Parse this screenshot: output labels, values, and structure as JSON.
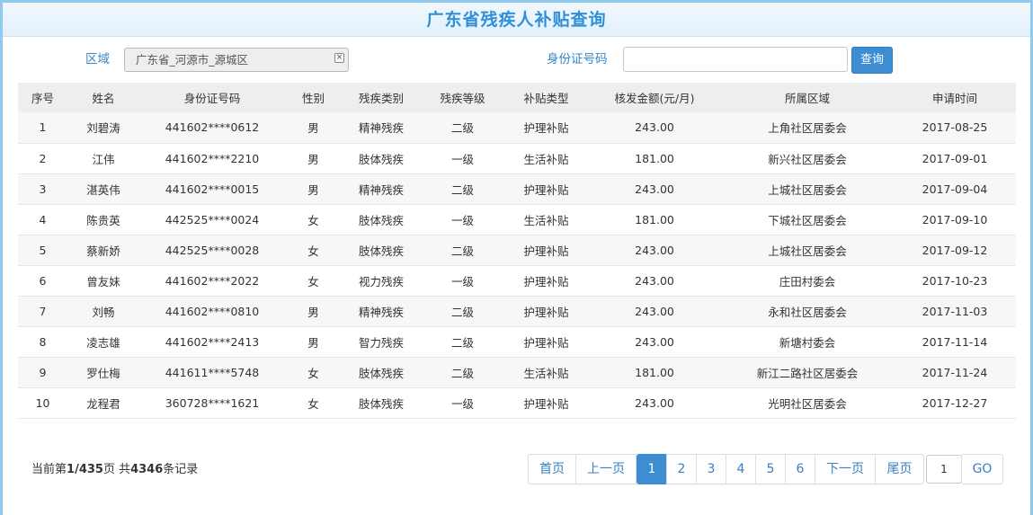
{
  "page": {
    "title": "广东省残疾人补贴查询"
  },
  "search": {
    "region_label": "区域",
    "region_value": "广东省_河源市_源城区",
    "clear_icon": "close-x-icon",
    "id_label": "身份证号码",
    "id_value": "",
    "id_placeholder": "",
    "query_label": "查询"
  },
  "table": {
    "headers": [
      "序号",
      "姓名",
      "身份证号码",
      "性别",
      "残疾类别",
      "残疾等级",
      "补贴类型",
      "核发金额(元/月)",
      "所属区域",
      "申请时间"
    ],
    "rows": [
      [
        "1",
        "刘碧涛",
        "441602****0612",
        "男",
        "精神残疾",
        "二级",
        "护理补贴",
        "243.00",
        "上角社区居委会",
        "2017-08-25"
      ],
      [
        "2",
        "江伟",
        "441602****2210",
        "男",
        "肢体残疾",
        "一级",
        "生活补贴",
        "181.00",
        "新兴社区居委会",
        "2017-09-01"
      ],
      [
        "3",
        "湛英伟",
        "441602****0015",
        "男",
        "精神残疾",
        "二级",
        "护理补贴",
        "243.00",
        "上城社区居委会",
        "2017-09-04"
      ],
      [
        "4",
        "陈贵英",
        "442525****0024",
        "女",
        "肢体残疾",
        "一级",
        "生活补贴",
        "181.00",
        "下城社区居委会",
        "2017-09-10"
      ],
      [
        "5",
        "蔡新娇",
        "442525****0028",
        "女",
        "肢体残疾",
        "二级",
        "护理补贴",
        "243.00",
        "上城社区居委会",
        "2017-09-12"
      ],
      [
        "6",
        "曾友妹",
        "441602****2022",
        "女",
        "视力残疾",
        "一级",
        "护理补贴",
        "243.00",
        "庄田村委会",
        "2017-10-23"
      ],
      [
        "7",
        "刘畅",
        "441602****0810",
        "男",
        "精神残疾",
        "二级",
        "护理补贴",
        "243.00",
        "永和社区居委会",
        "2017-11-03"
      ],
      [
        "8",
        "凌志雄",
        "441602****2413",
        "男",
        "智力残疾",
        "二级",
        "护理补贴",
        "243.00",
        "新塘村委会",
        "2017-11-14"
      ],
      [
        "9",
        "罗仕梅",
        "441611****5748",
        "女",
        "肢体残疾",
        "二级",
        "生活补贴",
        "181.00",
        "新江二路社区居委会",
        "2017-11-24"
      ],
      [
        "10",
        "龙程君",
        "360728****1621",
        "女",
        "肢体残疾",
        "一级",
        "护理补贴",
        "243.00",
        "光明社区居委会",
        "2017-12-27"
      ]
    ]
  },
  "summary": {
    "prefix": "当前第",
    "current": "1",
    "slash": "/",
    "total_pages": "435",
    "mid": "页 共",
    "total_records": "4346",
    "suffix": "条记录"
  },
  "pager": {
    "first": "首页",
    "prev": "上一页",
    "pages": [
      "1",
      "2",
      "3",
      "4",
      "5",
      "6"
    ],
    "active_page": "1",
    "next": "下一页",
    "last": "尾页",
    "goto_value": "1",
    "go": "GO"
  },
  "colors": {
    "title": "#2f8fd8",
    "accent": "#3c8dd1",
    "label": "#3b86c4",
    "frame": "#8fcaf0"
  }
}
